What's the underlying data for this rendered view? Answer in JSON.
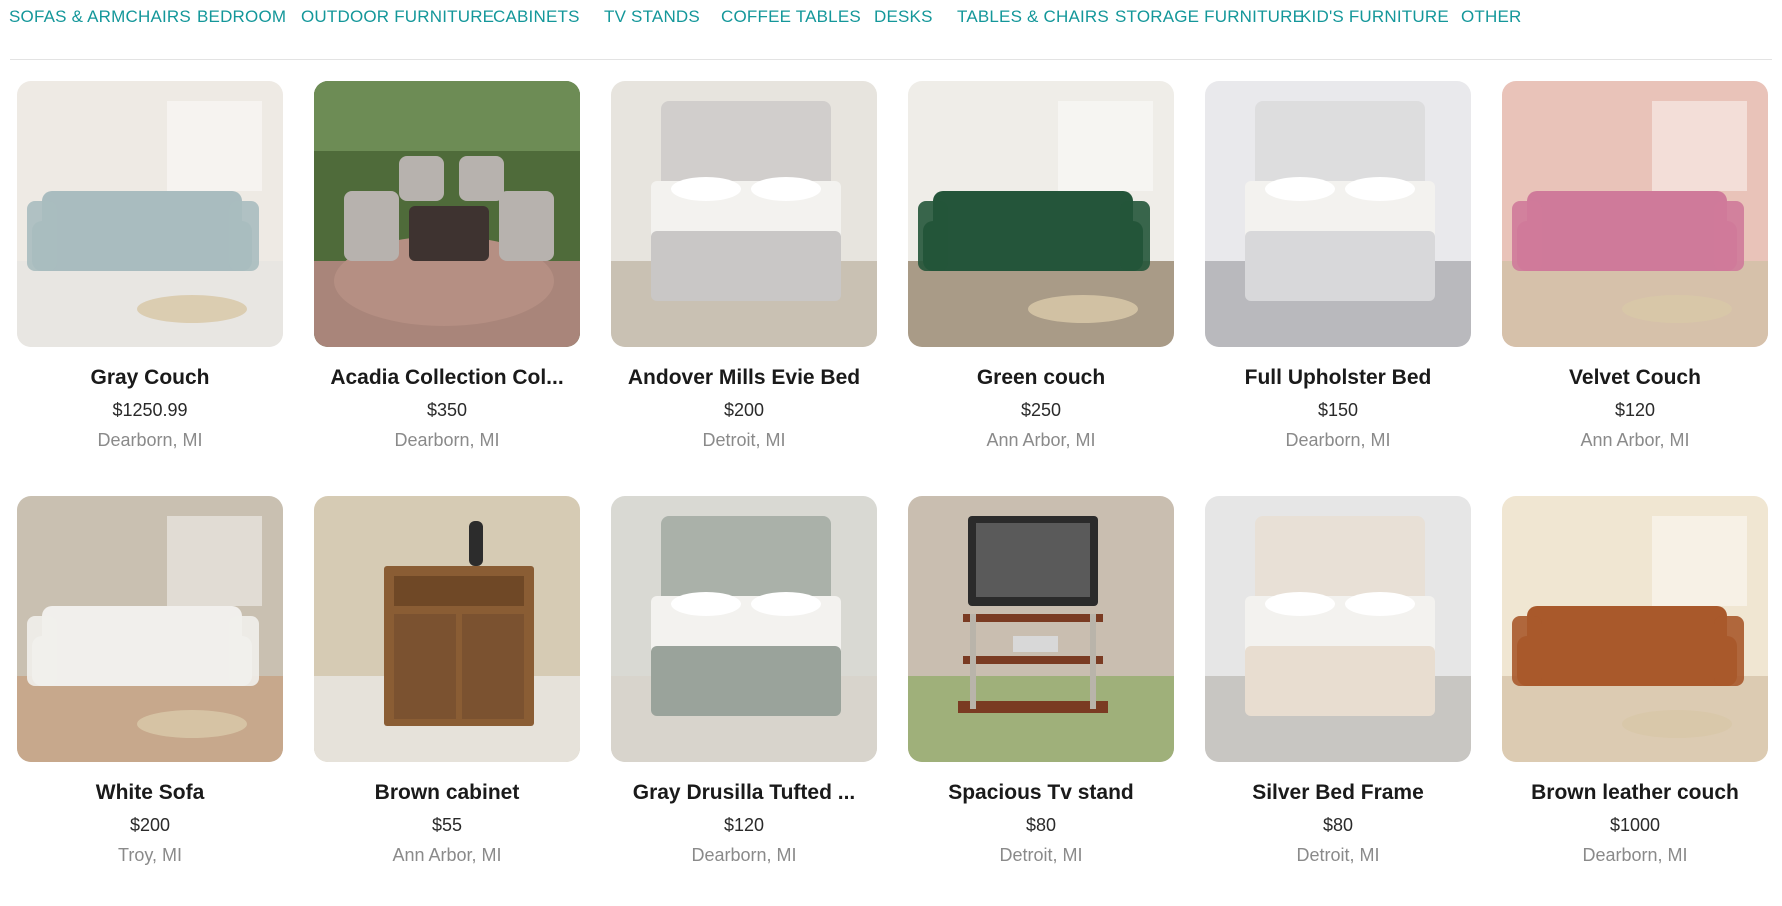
{
  "nav": {
    "categories": [
      "SOFAS & ARMCHAIRS",
      "BEDROOM",
      "OUTDOOR FURNITURE",
      "CABINETS",
      "TV STANDS",
      "COFFEE TABLES",
      "DESKS",
      "TABLES & CHAIRS",
      "STORAGE FURNITURE",
      "KID'S FURNITURE",
      "OTHER"
    ]
  },
  "listings": [
    {
      "title": "Gray Couch",
      "price": "$1250.99",
      "location": "Dearborn, MI",
      "image": "sofa-photo",
      "colors": {
        "wall": "#eeeae4",
        "floor": "#e8e6e2",
        "item": "#a9bcbf"
      }
    },
    {
      "title": "Acadia Collection Col...",
      "price": "$350",
      "location": "Dearborn, MI",
      "image": "patio-set-photo",
      "colors": {
        "wall": "#4f6b3a",
        "floor": "#a9857a",
        "item": "#b7b2ae"
      }
    },
    {
      "title": "Andover Mills Evie Bed",
      "price": "$200",
      "location": "Detroit, MI",
      "image": "bed-photo",
      "colors": {
        "wall": "#e7e4de",
        "floor": "#c9c1b3",
        "item": "#c9c7c6"
      }
    },
    {
      "title": "Green couch",
      "price": "$250",
      "location": "Ann Arbor, MI",
      "image": "sofa-photo",
      "colors": {
        "wall": "#efede8",
        "floor": "#a99b87",
        "item": "#24553a"
      }
    },
    {
      "title": "Full Upholster Bed",
      "price": "$150",
      "location": "Dearborn, MI",
      "image": "bed-photo",
      "colors": {
        "wall": "#e9e9ec",
        "floor": "#b9b9bd",
        "item": "#d8d8da"
      }
    },
    {
      "title": "Velvet Couch",
      "price": "$120",
      "location": "Ann Arbor, MI",
      "image": "sofa-photo",
      "colors": {
        "wall": "#e9c3b9",
        "floor": "#d6c1aa",
        "item": "#cf7a9a"
      }
    },
    {
      "title": "White Sofa",
      "price": "$200",
      "location": "Troy, MI",
      "image": "sofa-photo",
      "colors": {
        "wall": "#c9c0b1",
        "floor": "#c7a88c",
        "item": "#f1efec"
      }
    },
    {
      "title": "Brown cabinet",
      "price": "$55",
      "location": "Ann Arbor, MI",
      "image": "cabinet-photo",
      "colors": {
        "wall": "#d6cbb4",
        "floor": "#e6e2da",
        "item": "#8a5d34"
      }
    },
    {
      "title": "Gray Drusilla Tufted ...",
      "price": "$120",
      "location": "Dearborn, MI",
      "image": "bed-photo",
      "colors": {
        "wall": "#d9d9d3",
        "floor": "#d8d4cc",
        "item": "#9aa39b"
      }
    },
    {
      "title": "Spacious Tv stand",
      "price": "$80",
      "location": "Detroit, MI",
      "image": "tv-stand-photo",
      "colors": {
        "wall": "#c9beb0",
        "floor": "#9fb07a",
        "item": "#7a3b22"
      }
    },
    {
      "title": "Silver Bed Frame",
      "price": "$80",
      "location": "Detroit, MI",
      "image": "bed-photo",
      "colors": {
        "wall": "#e6e6e6",
        "floor": "#c8c6c2",
        "item": "#e8ddd0"
      }
    },
    {
      "title": "Brown leather couch",
      "price": "$1000",
      "location": "Dearborn, MI",
      "image": "sofa-photo",
      "colors": {
        "wall": "#f0e6d2",
        "floor": "#dccbb2",
        "item": "#a9592b"
      }
    }
  ]
}
